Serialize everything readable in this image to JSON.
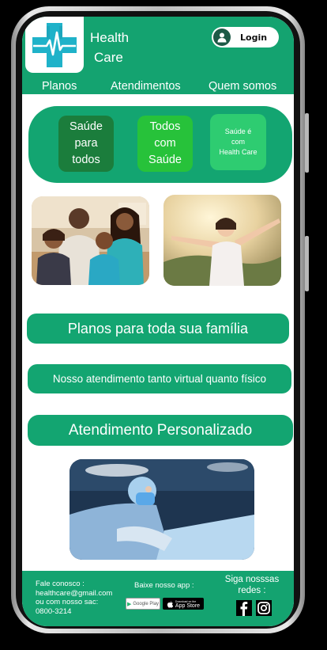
{
  "header": {
    "brand_line1": "Health",
    "brand_line2": "Care",
    "login_label": "Login"
  },
  "nav": {
    "items": [
      {
        "label": "Planos"
      },
      {
        "label": "Atendimentos"
      },
      {
        "label": "Quem somos"
      }
    ]
  },
  "banner": {
    "tiles": [
      {
        "label": "Saúde\npara\ntodos",
        "color": "#1b7d3c"
      },
      {
        "label": "Todos\ncom\nSaúde",
        "color": "#27c23a"
      },
      {
        "label": "Saúde é\ncom\nHealth Care",
        "color": "#2ecc71"
      }
    ]
  },
  "features": {
    "family_plans": "Planos para toda sua família",
    "service": "Nosso atendimento tanto virtual quanto físico",
    "personalized": "Atendimento Personalizado"
  },
  "footer": {
    "contact_line1": "Fale conosco :",
    "contact_line2": "healthcare@gmail.com",
    "contact_line3": "ou com nosso sac:",
    "contact_line4": "0800-3214",
    "app_label": "Baixe nosso app :",
    "google_play": "Google Play",
    "app_store_small": "Download on the",
    "app_store": "App Store",
    "social_line1": "Siga nosssas",
    "social_line2": "redes :"
  },
  "colors": {
    "brand": "#14a370",
    "logo_cross": "#1fb2c9"
  }
}
